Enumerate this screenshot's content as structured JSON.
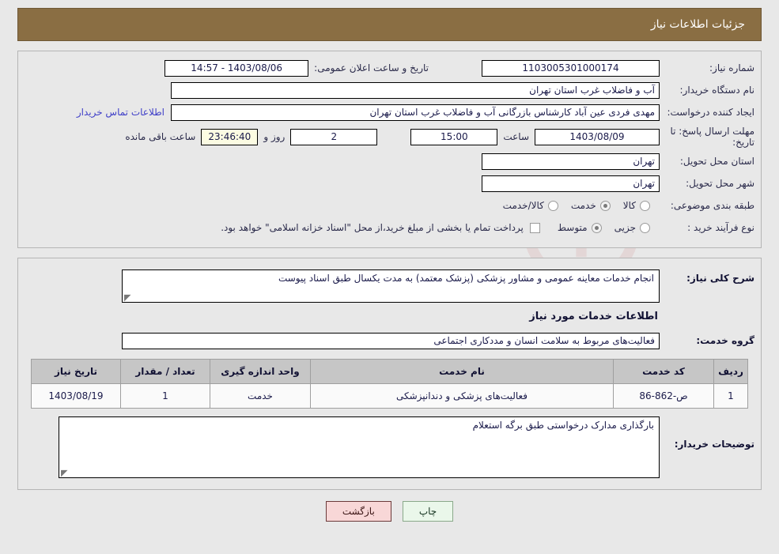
{
  "header": {
    "title": "جزئیات اطلاعات نیاز",
    "bar_color": "#8a6e43",
    "text_color": "#ffffff"
  },
  "top_panel": {
    "need_number": {
      "label": "شماره نیاز:",
      "value": "1103005301000174"
    },
    "announce": {
      "label": "تاریخ و ساعت اعلان عمومی:",
      "value": "1403/08/06 - 14:57"
    },
    "buyer_org": {
      "label": "نام دستگاه خریدار:",
      "value": "آب و فاضلاب غرب استان تهران"
    },
    "requester": {
      "label": "ایجاد کننده درخواست:",
      "value": "مهدی فردی عین آباد کارشناس بازرگانی آب و فاضلاب غرب استان تهران"
    },
    "contact_link": "اطلاعات تماس خریدار",
    "deadline": {
      "label": "مهلت ارسال پاسخ: تا تاریخ:",
      "date": "1403/08/09",
      "time_label": "ساعت",
      "time": "15:00",
      "days": "2",
      "days_label": "روز و",
      "countdown": "23:46:40",
      "countdown_label": "ساعت باقی مانده"
    },
    "province": {
      "label": "استان محل تحویل:",
      "value": "تهران"
    },
    "city": {
      "label": "شهر محل تحویل:",
      "value": "تهران"
    },
    "category": {
      "label": "طبقه بندی موضوعی:",
      "options": [
        {
          "label": "کالا",
          "selected": false
        },
        {
          "label": "خدمت",
          "selected": true
        },
        {
          "label": "کالا/خدمت",
          "selected": false
        }
      ]
    },
    "purchase_type": {
      "label": "نوع فرآیند خرید :",
      "options": [
        {
          "label": "جزیی",
          "selected": false
        },
        {
          "label": "متوسط",
          "selected": true
        }
      ],
      "checkbox_checked": false,
      "note": "پرداخت تمام یا بخشی از مبلغ خرید،از محل \"اسناد خزانه اسلامی\" خواهد بود."
    }
  },
  "mid_panel": {
    "summary": {
      "label": "شرح کلی نیاز:",
      "value": "انجام خدمات معاینه عمومی و مشاور پزشکی (پزشک معتمد) به مدت یکسال طبق اسناد پیوست"
    },
    "section_heading": "اطلاعات خدمات مورد نیاز",
    "service_group": {
      "label": "گروه خدمت:",
      "value": "فعالیت‌های مربوط به سلامت انسان و مددکاری اجتماعی"
    },
    "table": {
      "columns": [
        "ردیف",
        "کد خدمت",
        "نام خدمت",
        "واحد اندازه گیری",
        "تعداد / مقدار",
        "تاریخ نیاز"
      ],
      "rows": [
        {
          "radif": "1",
          "code": "ص-862-86",
          "name": "فعالیت‌های پزشکی و دندانپزشکی",
          "unit": "خدمت",
          "qty": "1",
          "need_date": "1403/08/19"
        }
      ]
    },
    "buyer_notes": {
      "label": "توضیحات خریدار:",
      "value": "بارگذاری مدارک درخواستی طبق برگه استعلام"
    }
  },
  "buttons": {
    "print": "چاپ",
    "back": "بازگشت"
  },
  "watermark": {
    "text": "AriaTender.net"
  }
}
